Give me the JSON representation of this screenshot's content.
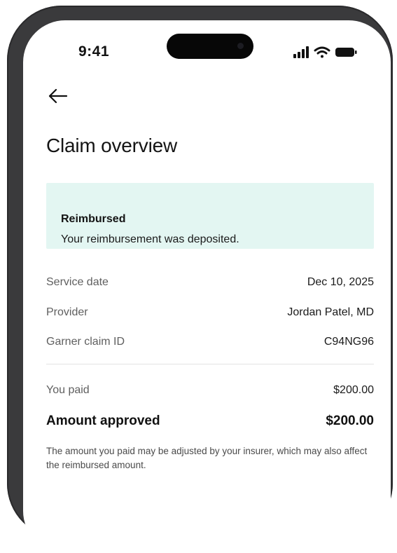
{
  "status_bar": {
    "time": "9:41",
    "icons": [
      "signal-icon",
      "wifi-icon",
      "battery-icon"
    ]
  },
  "nav": {
    "back_icon": "arrow-left-icon"
  },
  "page": {
    "title": "Claim overview"
  },
  "banner": {
    "title": "Reimbursed",
    "message": "Your reimbursement was deposited.",
    "background_color": "#e3f6f2"
  },
  "details": [
    {
      "label": "Service date",
      "value": "Dec 10, 2025"
    },
    {
      "label": "Provider",
      "value": "Jordan Patel, MD"
    },
    {
      "label": "Garner claim ID",
      "value": "C94NG96"
    }
  ],
  "payment": {
    "you_paid_label": "You paid",
    "you_paid_value": "$200.00",
    "approved_label": "Amount approved",
    "approved_value": "$200.00"
  },
  "disclaimer": "The amount you paid may be adjusted by your insurer, which may also affect the reimbursed amount."
}
